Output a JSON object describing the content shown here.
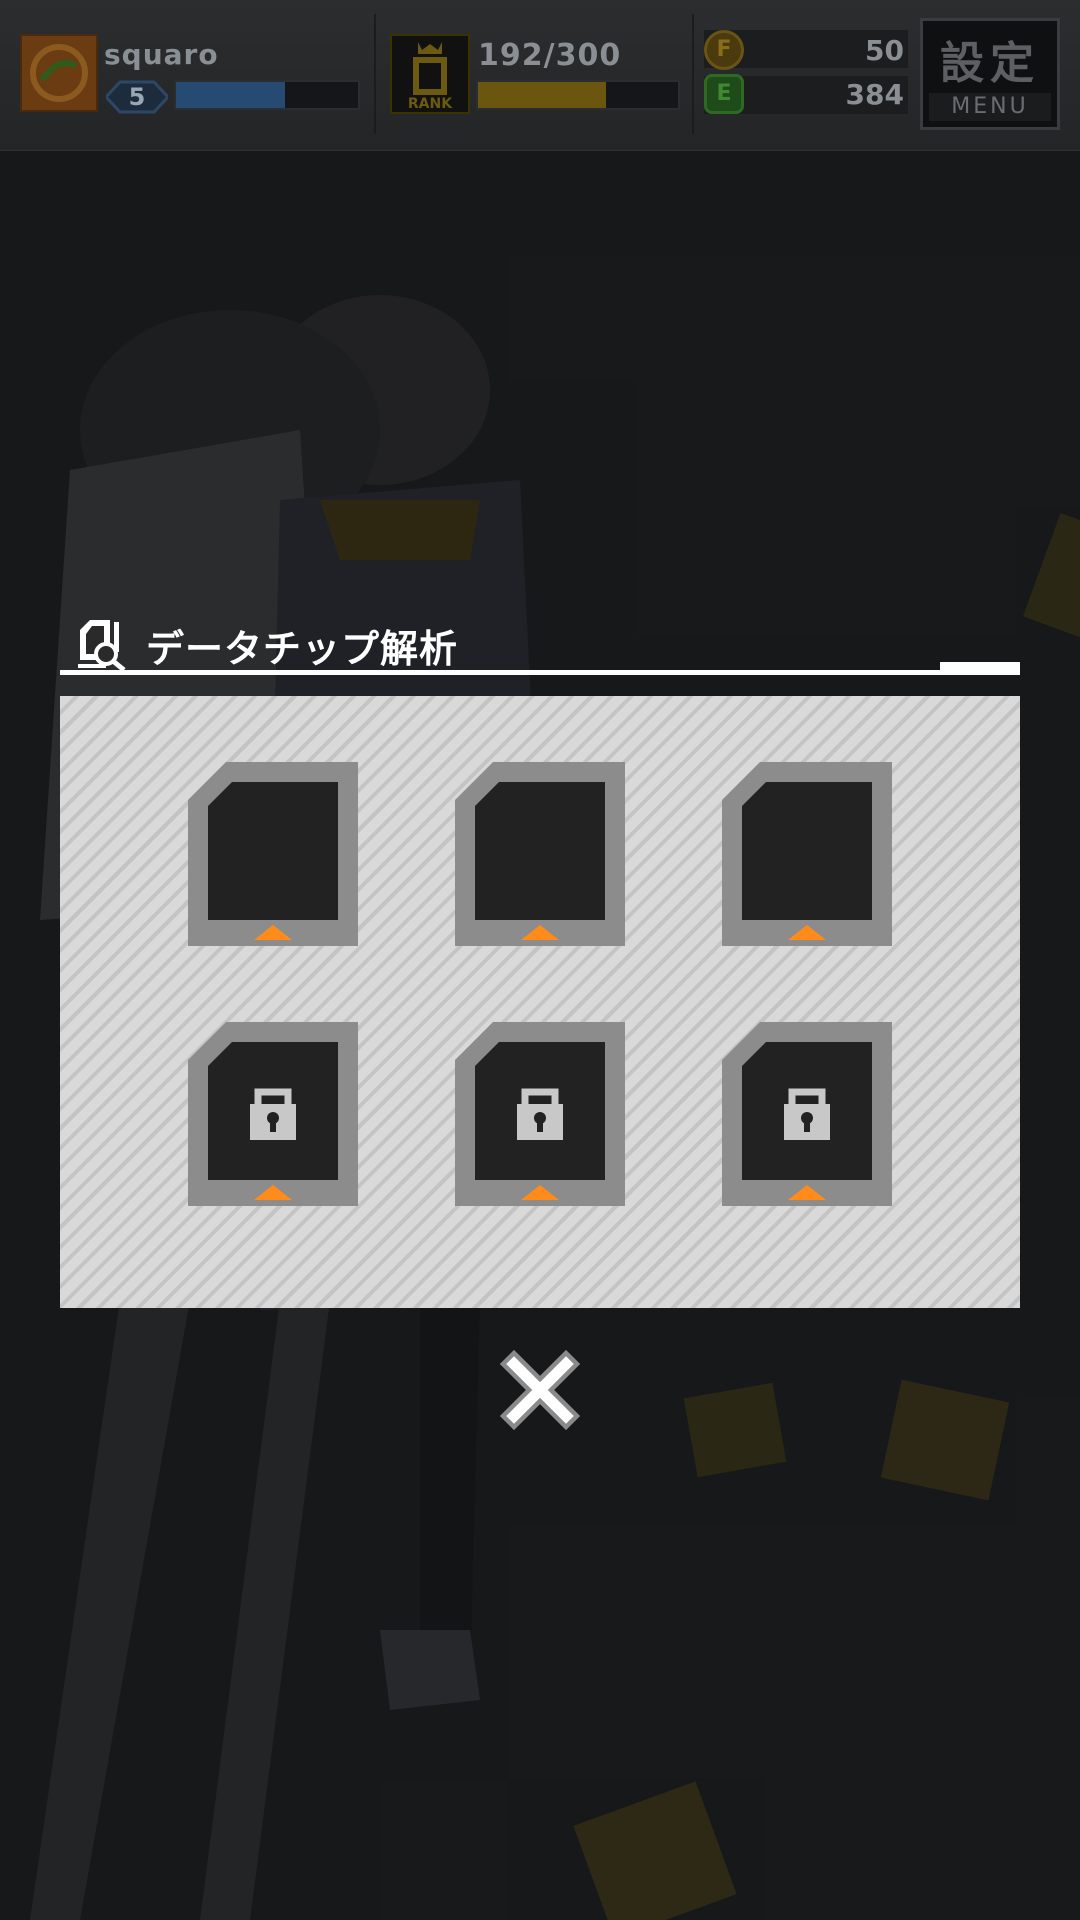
{
  "hud": {
    "player_name": "squaro",
    "level": "5",
    "exp_progress": 0.6,
    "rank_progress_text": "192/300",
    "rank_progress": 0.64,
    "rank_icon_label": "RANK",
    "currency_f_label": "F",
    "currency_f_value": "50",
    "currency_e_label": "E",
    "currency_e_value": "384",
    "menu_kanji": "設定",
    "menu_label": "MENU"
  },
  "panel": {
    "title": "データチップ解析",
    "slots": [
      {
        "state": "empty"
      },
      {
        "state": "empty"
      },
      {
        "state": "empty"
      },
      {
        "state": "locked"
      },
      {
        "state": "locked"
      },
      {
        "state": "locked"
      }
    ]
  },
  "colors": {
    "accent_orange": "#ff8c1a",
    "slot_frame": "#8c8c8c",
    "slot_inner": "#222222",
    "panel_bg": "#d9d9d9"
  },
  "icons": {
    "title": "data-chip-search-icon",
    "close": "close-x-icon",
    "lock": "lock-icon"
  }
}
